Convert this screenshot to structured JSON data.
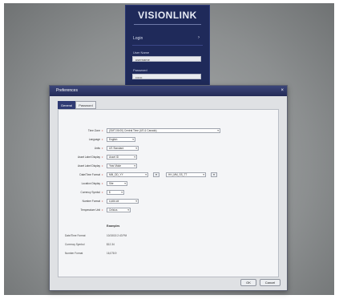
{
  "login": {
    "logo": "VISIONLINK",
    "heading": "Login",
    "arrow": "›",
    "username_label": "User Name",
    "username_value": "username",
    "password_label": "Password",
    "password_value": "••••••"
  },
  "dialog": {
    "title": "Preferences",
    "close": "×",
    "tabs": [
      {
        "label": "General",
        "active": true
      },
      {
        "label": "Password",
        "active": false
      }
    ],
    "rows": [
      {
        "label": "Time Zone",
        "value": "(GMT-06:00) Central Time (US & Canada)"
      },
      {
        "label": "Language",
        "value": "English"
      },
      {
        "label": "Units",
        "value": "US Standard"
      },
      {
        "label": "Asset Label Display",
        "value": "Asset ID"
      },
      {
        "label": "Asset Label Display",
        "value": "Year Make"
      },
      {
        "label": "Date/Time Format",
        "value": "MM_DD_YY",
        "extra": "HH_MM_SS_TT"
      },
      {
        "label": "Location Display",
        "value": "Site"
      },
      {
        "label": "Currency Symbol",
        "value": "$"
      },
      {
        "label": "Number Format",
        "value": "#,###.##"
      },
      {
        "label": "Temperature Unit",
        "value": "Celsius"
      }
    ],
    "examples": {
      "heading": "Examples",
      "items": [
        {
          "label": "Date/Time Format",
          "value": "10/15/15 2:43 PM"
        },
        {
          "label": "Currency Symbol",
          "value": "$12.34"
        },
        {
          "label": "Number Format",
          "value": "16,078.9"
        }
      ]
    },
    "ok_label": "OK",
    "cancel_label": "Cancel"
  }
}
